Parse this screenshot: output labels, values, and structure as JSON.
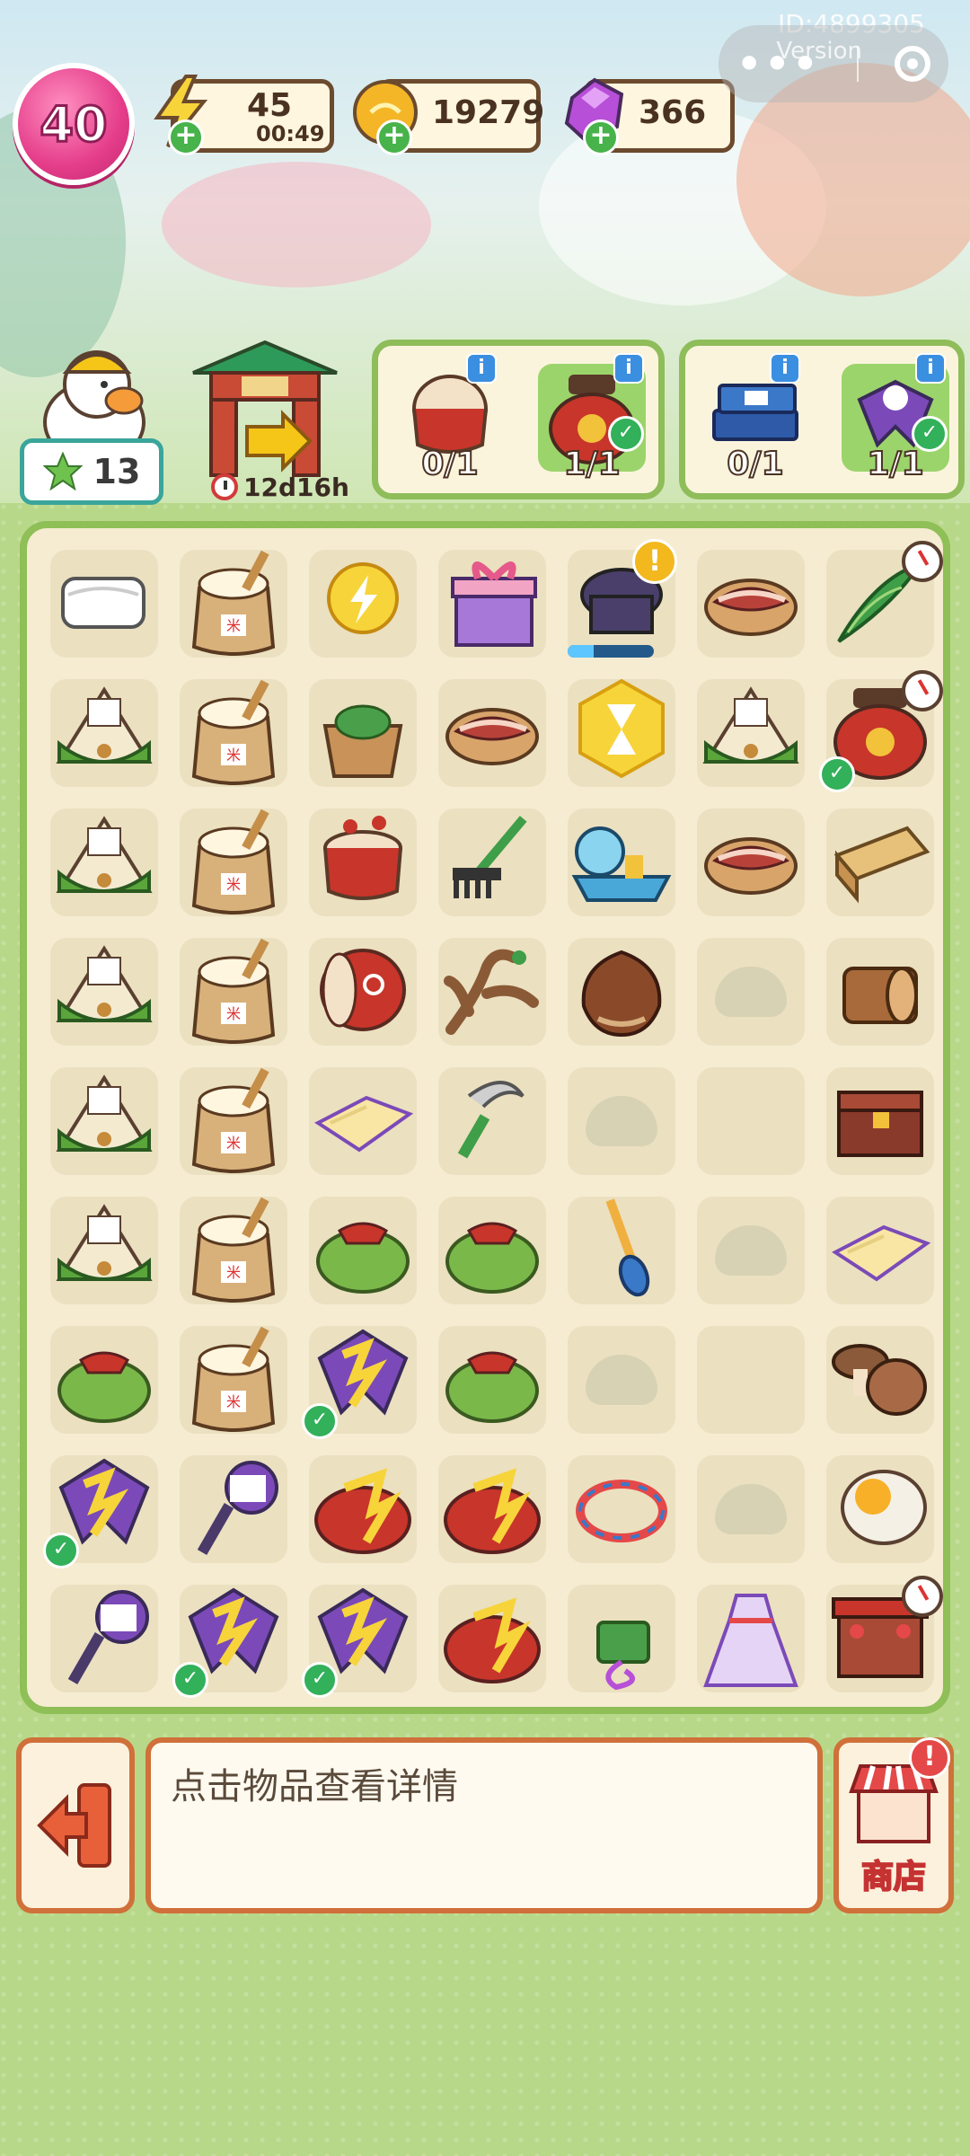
{
  "hud": {
    "level": "40",
    "energy": {
      "value": "45",
      "timer": "00:49",
      "plus": "+"
    },
    "coins": {
      "value": "19279",
      "plus": "+"
    },
    "gems": {
      "value": "366",
      "plus": "+"
    },
    "id_text": "ID:4899305",
    "version_text": "Version",
    "more": "•••"
  },
  "player": {
    "stars": "13"
  },
  "event": {
    "timer": "12d16h"
  },
  "orders": [
    {
      "items": [
        {
          "icon": "drum-icon",
          "count": "0/1",
          "done": false
        },
        {
          "icon": "wine-jar-icon",
          "count": "1/1",
          "done": true
        }
      ]
    },
    {
      "items": [
        {
          "icon": "books-icon",
          "count": "0/1",
          "done": false
        },
        {
          "icon": "swallow-kite-icon",
          "count": "1/1",
          "done": true
        }
      ]
    }
  ],
  "board": [
    [
      "cloth",
      "rice-sack",
      "energy-coin",
      "gift-box",
      "cauldron",
      "bacon",
      "bamboo-leaves"
    ],
    [
      "zongzi",
      "rice-sack",
      "zongzi-basket",
      "bacon",
      "hourglass",
      "zongzi",
      "wine-jar"
    ],
    [
      "zongzi",
      "rice-sack",
      "drum",
      "rake",
      "dragon-boat",
      "bacon",
      "wood-plank"
    ],
    [
      "zongzi",
      "rice-sack",
      "barrel-drum",
      "branch",
      "chestnut",
      "locked",
      "log"
    ],
    [
      "zongzi",
      "rice-sack",
      "cloth-yellow",
      "sickle",
      "locked",
      "empty",
      "wooden-chest"
    ],
    [
      "zongzi",
      "rice-sack",
      "pouch",
      "pouch",
      "paddle",
      "locked",
      "cloth-yellow"
    ],
    [
      "pouch",
      "rice-sack",
      "swallow-kite",
      "pouch",
      "locked",
      "empty",
      "mushrooms"
    ],
    [
      "swallow-kite",
      "kite-spool",
      "tiger-pouch",
      "tiger-pouch",
      "five-color-rope",
      "locked",
      "salted-egg"
    ],
    [
      "kite-spool",
      "swallow-kite",
      "swallow-kite",
      "tiger-pouch",
      "tassel-charm",
      "hanfu-dress",
      "market-stall"
    ]
  ],
  "cell_badges": {
    "checks": [
      "1-6",
      "6-2",
      "7-0",
      "8-1",
      "8-2"
    ],
    "timers": [
      "0-6",
      "1-6",
      "8-6"
    ],
    "alerts": [
      "0-4"
    ],
    "progress": {
      "cell": "0-4",
      "fraction": 0.3
    }
  },
  "bottom": {
    "info_text": "点击物品查看详情",
    "shop_label": "商店",
    "shop_alert": "!"
  },
  "colors": {
    "board_border": "#8fbf57",
    "panel_border": "#d0703a",
    "level_pink": "#e53d8a"
  }
}
